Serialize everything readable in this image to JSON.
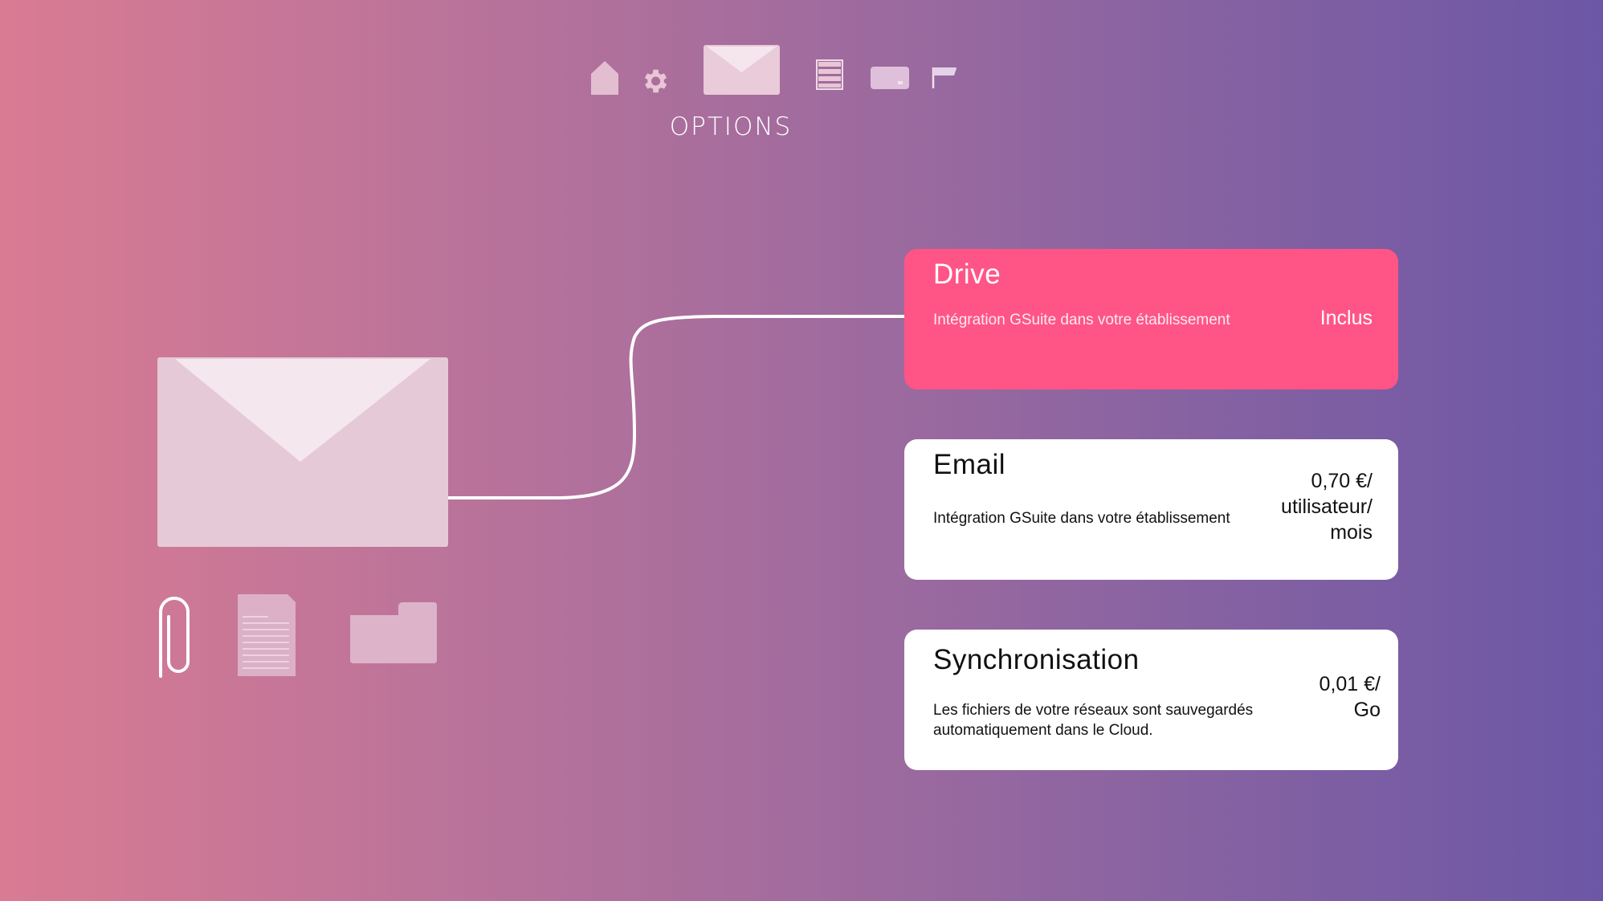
{
  "nav": {
    "active_label": "OPTIONS",
    "icons": [
      "home-icon",
      "gear-icon",
      "mail-icon",
      "list-icon",
      "card-icon",
      "flag-icon"
    ]
  },
  "illustration": {
    "icons": [
      "envelope-icon",
      "paperclip-icon",
      "document-icon",
      "folder-icon"
    ]
  },
  "options": {
    "drive": {
      "title": "Drive",
      "description": "Intégration GSuite dans votre établissement",
      "price": "Inclus"
    },
    "email": {
      "title": "Email",
      "description": "Intégration GSuite dans votre établissement",
      "price": "0,70 €/ utilisateur/ mois"
    },
    "sync": {
      "title": "Synchronisation",
      "description": "Les fichiers de votre réseaux sont sauvegardés automatiquement dans le Cloud.",
      "price": "0,01 €/ Go"
    }
  },
  "colors": {
    "gradient_start": "#d97b93",
    "gradient_end": "#6c57a6",
    "active_card": "#ff5586",
    "card": "#ffffff"
  }
}
